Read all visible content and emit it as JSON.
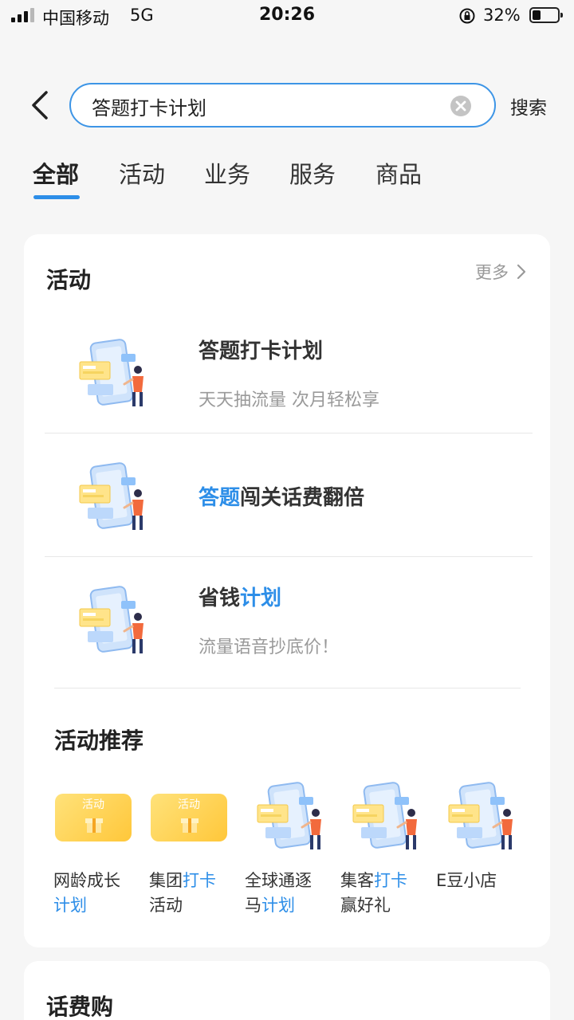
{
  "status_bar": {
    "carrier": "中国移动",
    "network": "5G",
    "time": "20:26",
    "battery_text": "32%",
    "battery_level": 0.32
  },
  "search": {
    "value": "答题打卡计划",
    "button_label": "搜索"
  },
  "tabs": [
    {
      "label": "全部",
      "active": true
    },
    {
      "label": "活动",
      "active": false
    },
    {
      "label": "业务",
      "active": false
    },
    {
      "label": "服务",
      "active": false
    },
    {
      "label": "商品",
      "active": false
    }
  ],
  "activity_section": {
    "title": "活动",
    "more_label": "更多",
    "items": [
      {
        "title_highlight": "答题打卡计划",
        "title_rest": "",
        "subtitle": "天天抽流量 次月轻松享"
      },
      {
        "title_highlight": "答题",
        "title_rest": "闯关话费翻倍",
        "subtitle": ""
      },
      {
        "title_plain": "省钱",
        "title_highlight": "计划",
        "subtitle": "流量语音抄底价！"
      }
    ]
  },
  "recommend_section": {
    "title": "活动推荐",
    "items": [
      {
        "text_a": "网龄成长",
        "text_b": "计划",
        "badge": "活动"
      },
      {
        "text_a": "集团",
        "text_b": "打卡",
        "text_c": "活动",
        "badge": "活动"
      },
      {
        "text_a": "全球通逐",
        "text_b": "马",
        "text_c": "计划"
      },
      {
        "text_a": "集客",
        "text_b": "打卡",
        "text_c": "赢好礼"
      },
      {
        "text_a": "E豆小店"
      }
    ]
  },
  "next_section": {
    "title": "话费购"
  },
  "colors": {
    "accent": "#2d8ee8",
    "background": "#f6f6f6"
  },
  "icons": [
    "signal-icon",
    "rotation-lock-icon",
    "battery-icon",
    "back-arrow-icon",
    "clear-icon",
    "chevron-right-icon",
    "phone-illustration-icon",
    "gift-icon"
  ]
}
